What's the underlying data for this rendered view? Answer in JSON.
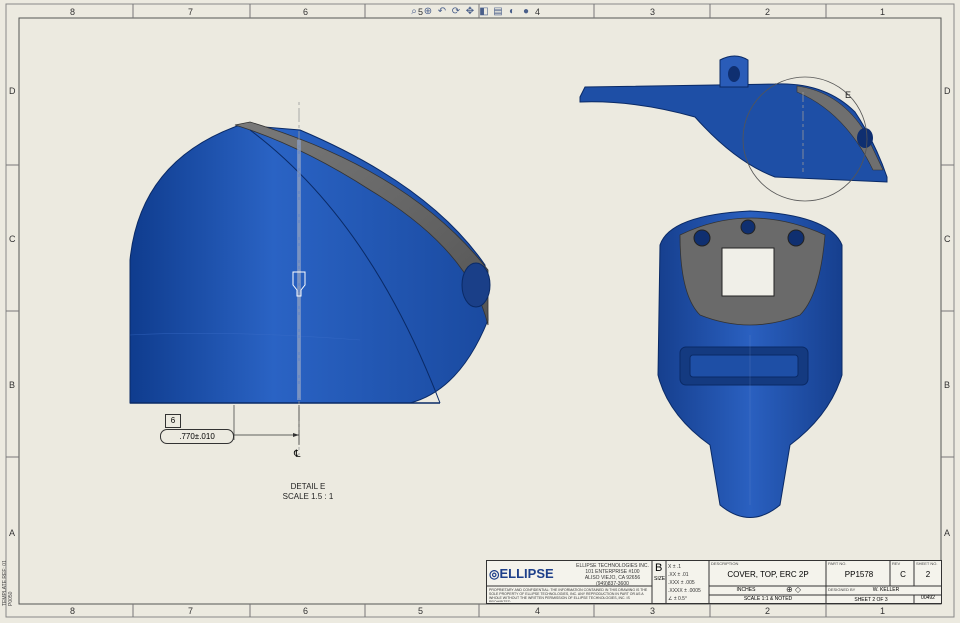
{
  "border": {
    "columns_top": [
      "8",
      "7",
      "6",
      "5",
      "4",
      "3",
      "2",
      "1"
    ],
    "columns_bottom": [
      "8",
      "7",
      "6",
      "5",
      "4",
      "3",
      "2",
      "1"
    ],
    "rows_left": [
      "D",
      "C",
      "B",
      "A"
    ],
    "rows_right": [
      "D",
      "C",
      "B",
      "A"
    ]
  },
  "toolbar": {
    "icons": [
      "zoom-to-fit-icon",
      "zoom-area-icon",
      "previous-view-icon",
      "rotate-icon",
      "pan-icon",
      "section-view-icon",
      "display-style-icon",
      "hide-show-icon",
      "appearance-icon",
      "scene-icon"
    ]
  },
  "detail": {
    "label_line1": "DETAIL E",
    "label_line2": "SCALE 1.5 : 1",
    "balloon": "6",
    "dimension": ".770±.010",
    "centerline_symbol": "℄",
    "callout_letter": "E"
  },
  "template_note": "TEMPLATE REF: 01 P0050",
  "title_block": {
    "company_logo_text": "ELLIPSE",
    "company_name": "ELLIPSE TECHNOLOGIES INC.",
    "address1": "101 ENTERPRISE #100",
    "address2": "ALISO VIEJO, CA 92656",
    "phone": "(949)837-3600",
    "proprietary": "PROPRIETARY AND CONFIDENTIAL: THE INFORMATION CONTAINED IN THIS DRAWING IS THE SOLE PROPERTY OF ELLIPSE TECHNOLOGIES, INC. ANY REPRODUCTION IN PART OR AS A WHOLE WITHOUT THE WRITTEN PERMISSION OF ELLIPSE TECHNOLOGIES, INC. IS PROHIBITED.",
    "size": "B",
    "size_label": "SIZE",
    "tol1": "X ± .1",
    "tol2": ".XX ± .01",
    "tol3": ".XXX ± .005",
    "tol4": ".XXXX ± .0005",
    "angle_tol": "± 0.5°",
    "description_label": "DESCRIPTION",
    "description": "COVER, TOP, ERC 2P",
    "units": "INCHES",
    "scale": "SCALE 1:1 & NOTED",
    "part_no_label": "PART NO.",
    "part_no": "PP1578",
    "rev_label": "REV",
    "rev": "C",
    "sheet_label": "SHEET NO.",
    "sheet_no": "2",
    "drawn_label": "DESIGNED BY",
    "drawn_by": "W. KELLER",
    "sheet_of": "SHEET 2 OF 3",
    "doc_no": "00492"
  },
  "colors": {
    "part_blue": "#1e4fa6",
    "part_dark": "#0f2f70",
    "part_grey": "#6a6a6a",
    "sheet": "#eceae0",
    "border": "#555555"
  }
}
